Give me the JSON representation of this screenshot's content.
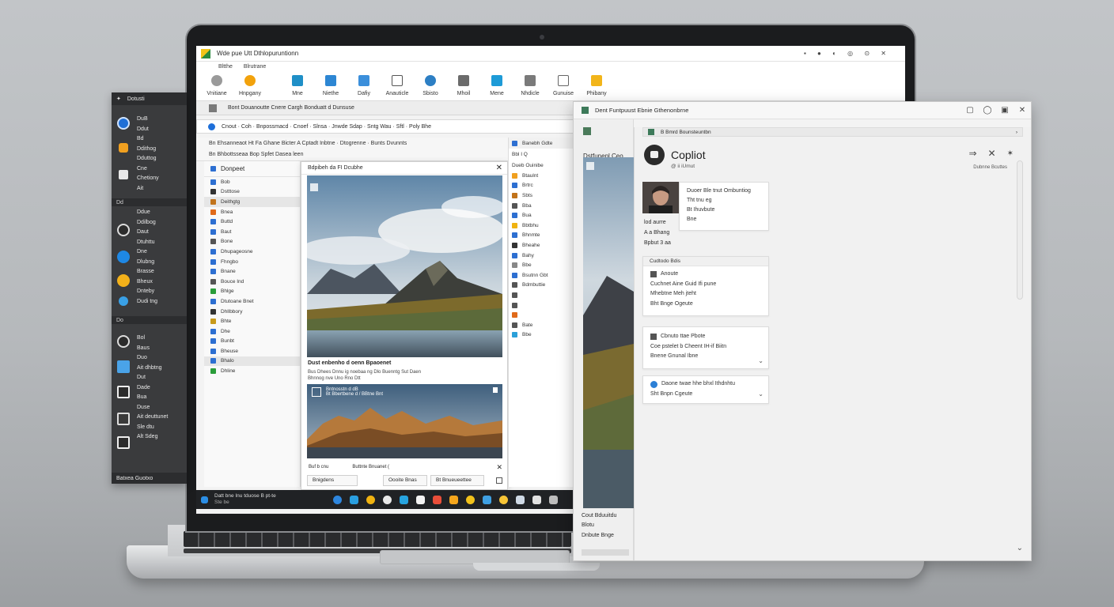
{
  "side_panel": {
    "header": "Dotusti",
    "items_a": [
      "DuB",
      "Ddut",
      "Bd",
      "Ddithog",
      "Dduttog",
      "Cne",
      "Chetiony",
      "Ait"
    ],
    "section_b": "Dd",
    "items_b": [
      "Ddue",
      "Ddilbog",
      "Daut",
      "Dtuhttu",
      "Dne",
      "Dlubng",
      "Brasse",
      "Bheux",
      "Dnteby",
      "Dudi tng"
    ],
    "section_c": "Do",
    "items_c": [
      "Bol",
      "Baus",
      "Duo",
      "Ait dhbtng",
      "Dut",
      "Dade",
      "Bua",
      "Duse",
      "Ait deuttunet",
      "Sle dtu",
      "Alt Sdeg"
    ],
    "footer": "Batxea  Guotxo"
  },
  "ribbon_app": {
    "title": "Wde pue Utt Dthlopuruntionn",
    "menu_items": [
      "Bltthe",
      "Blrutrane"
    ],
    "ribbon_buttons": [
      "Vnitiane",
      "Hnpgany",
      "Mne",
      "Niethe",
      "Dafiy",
      "Anauticle",
      "Sbisto",
      "Mhoil",
      "Mene",
      "Nhdicle",
      "Gunuise",
      "Phibany"
    ],
    "explorer_bar": "Bont Douanoutte Cnere Cargh Bonduatt d Dunsuse",
    "address_bar": "Cnout · Coh · Bnpossmacd · Cnoef · Slnsa · Jnwde Sdap · Sntg Wau · Sftl · Poly Bhe",
    "toolbar_line1": "Bn  Ehsanneaot  Ht  Fa  Ghane Bicter  A  Cptadt Inbtne  ·  Dtogrenne  ·  Bunts Dvunnts",
    "toolbar_line2": "Bn  Bhbottsseaa Bop  Spfet  Dasea leen",
    "nav_title": "Donpeet",
    "nav_items": [
      "Bob",
      "Dstttose",
      "Deithgtg",
      "Bnea",
      "Buttd",
      "Baut",
      "Bone",
      "Dhupageosne",
      "Fhngbo",
      "Bnane",
      "Bouce Ind",
      "Bhlge",
      "Dtutoane Bnet",
      "Dhllbbory",
      "Bhte",
      "Dhe",
      "Bunbt",
      "Bheuse",
      "Bhalo",
      "Dhline"
    ],
    "preview_title": "Bdpibeh da FI Dcubhe",
    "caption_title": "Dust enbenho d oenn Bpaoenet",
    "caption_body": "Bus Dhees Dnnu ig noebaa ng Dlo Buenntg Sut Daen Bhnnog nve Uno Rno Dtt",
    "second_card_title": "Bntnosstn d dB",
    "second_card_sub": "Bt Bbertbene d / BBtne Bnt",
    "footer_label_left": "Buf b cnu",
    "footer_label_right": "Buttnte Bnuanet (",
    "footer_btns": [
      "Bnigdens",
      "Oooite Bnas",
      "Bt Bnueueettee"
    ],
    "list_header": "Banebh  Gdte",
    "list_sub1": "Bbl  I  Q",
    "list_sub2": "Dueb   Ouinibe",
    "list_items": [
      "Btaulnt",
      "Brtrc",
      "Sbts",
      "Bba",
      "Bua",
      "Bbtbhu",
      "Bhnmte",
      "Bheahe",
      "Bahy",
      "Bbe",
      "Bsutnn Gbt",
      "Bdmbuttie",
      "",
      "",
      "",
      "Bate",
      "Bbe"
    ],
    "taskbar_text": "Datt bne Inu tduose B pt-te",
    "taskbar_sub": "Ste be"
  },
  "right_window": {
    "title": "Dent Funtpuust Ebnie Gthenonbrne",
    "left_heading": "Dstfunenl Ceo",
    "left_footer": [
      "Cout Bduuitdu",
      "Blotu",
      "Dnbute Bnge"
    ],
    "copilot": {
      "path": "B Bmrd   Bounsteuntbn",
      "title": "Copliot",
      "subtitle": "@ ii iUmut",
      "actions_label": "Dubnne Bcuttes",
      "profile_lines": [
        "Duoer Ble tnut Ombuntiog",
        "Tht tnu eg",
        "Bt Ihuvbute",
        "Bne"
      ],
      "profile_caption": [
        "lod aurre",
        "A a Bhang",
        "Bpbut 3 aa"
      ],
      "card1_header": "Cudtodo Bdis",
      "card1_lines": [
        "Anoute",
        "Cuchnet Aine Guid Ifi pune",
        "Mhebtne Meh jteht",
        "Bht Bnge Ogeute"
      ],
      "card2_lines": [
        "Cbnuto ttae Pbote",
        "Coe pstelet b Cheent IH-if Biitn",
        "Bnene Gnunal Ibne"
      ],
      "card3_lines": [
        "Daone twae hhe bhxl Ithdnhtu",
        "Sht Bnpn Cgeute"
      ]
    }
  },
  "colors": {
    "dark_panel": "#3a3b3d",
    "accent_blue": "#2b7fd6",
    "accent_orange": "#f09a1a",
    "copilot_logo": "#2b2b2b"
  }
}
